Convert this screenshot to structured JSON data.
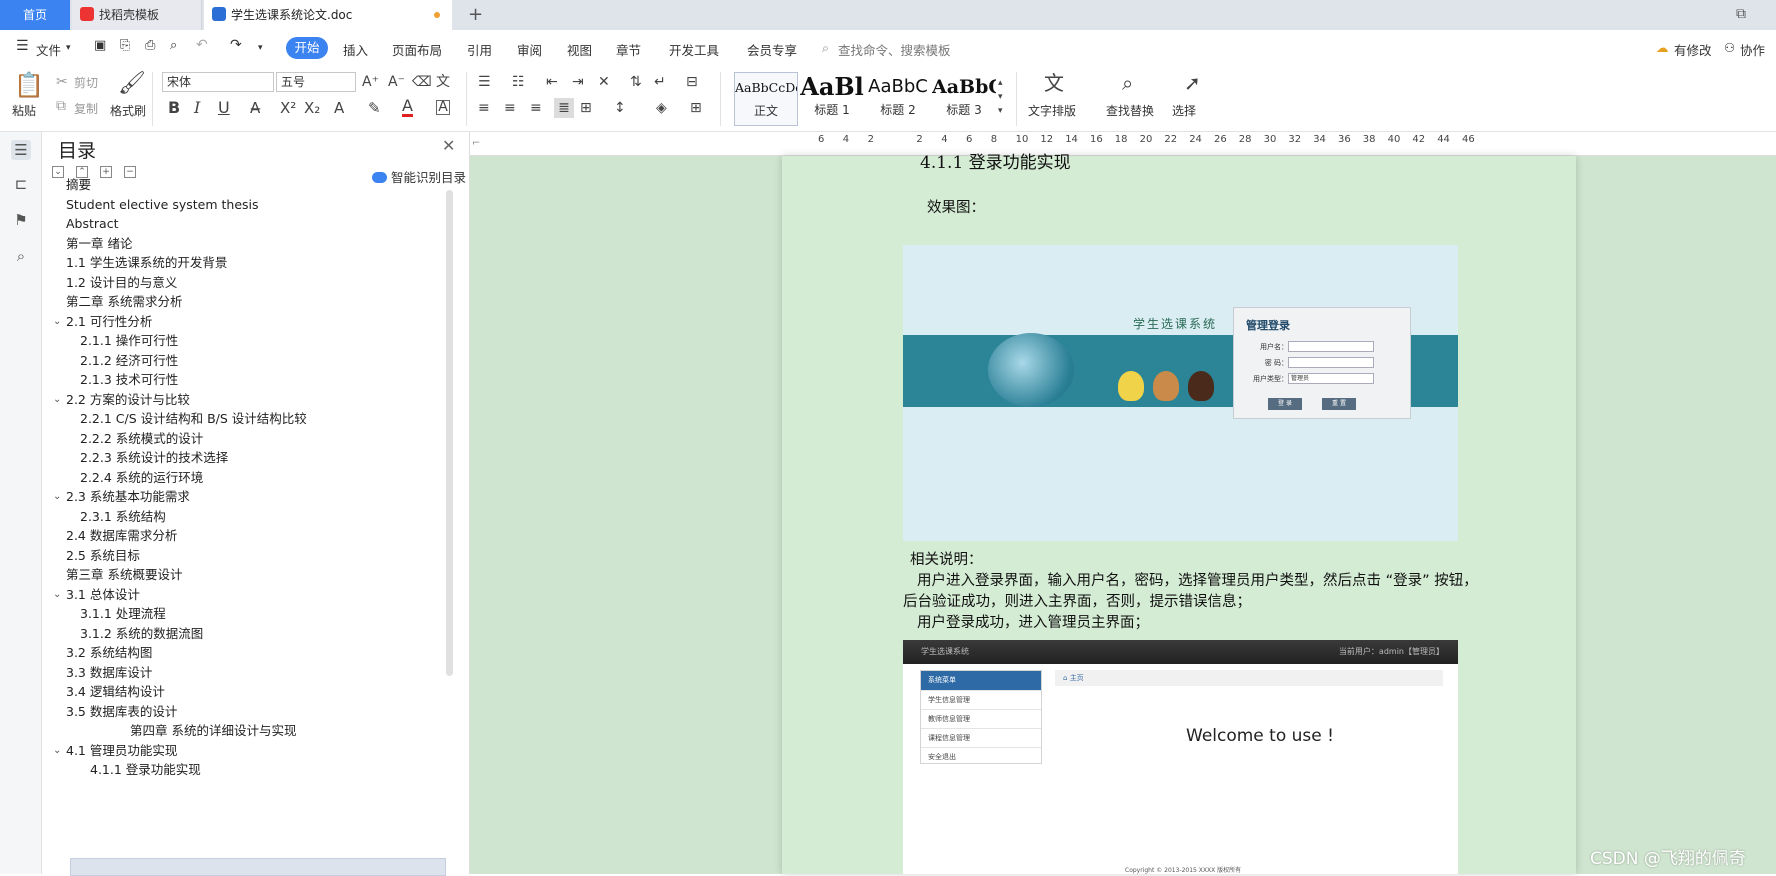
{
  "tabs": {
    "home": "首页",
    "template": "找稻壳模板",
    "document": "学生选课系统论文.doc",
    "add": "+"
  },
  "window_controls": {
    "layout": "⧉"
  },
  "menu": {
    "file": "文件",
    "start": "开始",
    "insert": "插入",
    "layout": "页面布局",
    "reference": "引用",
    "review": "审阅",
    "view": "视图",
    "chapter": "章节",
    "dev": "开发工具",
    "member": "会员专享",
    "search": "查找命令、搜索模板",
    "has_changes": "有修改",
    "collab": "协作"
  },
  "ribbon": {
    "paste": "粘贴",
    "cut": "剪切",
    "copy": "复制",
    "format_painter": "格式刷",
    "font": "宋体",
    "size": "五号",
    "styles": [
      {
        "sample": "AaBbCcDd",
        "name": "正文"
      },
      {
        "sample": "AaBl",
        "name": "标题 1"
      },
      {
        "sample": "AaBbC",
        "name": "标题 2"
      },
      {
        "sample": "AaBbC",
        "name": "标题 3"
      }
    ],
    "text_layout": "文字排版",
    "find_replace": "查找替换",
    "select": "选择"
  },
  "toc": {
    "title": "目录",
    "smart": "智能识别目录",
    "items": [
      {
        "text": "摘要",
        "level": 1,
        "arrow": false
      },
      {
        "text": "Student elective system thesis",
        "level": 1,
        "arrow": false
      },
      {
        "text": "Abstract",
        "level": 1,
        "arrow": false
      },
      {
        "text": "第一章  绪论",
        "level": 1,
        "arrow": false
      },
      {
        "text": "1.1  学生选课系统的开发背景",
        "level": 1,
        "arrow": false
      },
      {
        "text": "1.2 设计目的与意义",
        "level": 1,
        "arrow": false
      },
      {
        "text": "第二章  系统需求分析",
        "level": 1,
        "arrow": false
      },
      {
        "text": "2.1  可行性分析",
        "level": 1,
        "arrow": true
      },
      {
        "text": "2.1.1  操作可行性",
        "level": 2,
        "arrow": false
      },
      {
        "text": "2.1.2  经济可行性",
        "level": 2,
        "arrow": false
      },
      {
        "text": "2.1.3  技术可行性",
        "level": 2,
        "arrow": false
      },
      {
        "text": "2.2 方案的设计与比较",
        "level": 1,
        "arrow": true
      },
      {
        "text": "2.2.1 C/S 设计结构和 B/S 设计结构比较",
        "level": 2,
        "arrow": false
      },
      {
        "text": "2.2.2  系统模式的设计",
        "level": 2,
        "arrow": false
      },
      {
        "text": "2.2.3 系统设计的技术选择",
        "level": 2,
        "arrow": false
      },
      {
        "text": "2.2.4 系统的运行环境",
        "level": 2,
        "arrow": false
      },
      {
        "text": "2.3  系统基本功能需求",
        "level": 1,
        "arrow": true
      },
      {
        "text": "2.3.1  系统结构",
        "level": 2,
        "arrow": false
      },
      {
        "text": "2.4  数据库需求分析",
        "level": 1,
        "arrow": false
      },
      {
        "text": "2.5  系统目标",
        "level": 1,
        "arrow": false
      },
      {
        "text": "第三章  系统概要设计",
        "level": 1,
        "arrow": false
      },
      {
        "text": "3.1 总体设计",
        "level": 1,
        "arrow": true
      },
      {
        "text": "3.1.1  处理流程",
        "level": 2,
        "arrow": false
      },
      {
        "text": "3.1.2 系统的数据流图",
        "level": 2,
        "arrow": false
      },
      {
        "text": "3.2  系统结构图",
        "level": 1,
        "arrow": false
      },
      {
        "text": "3.3 数据库设计",
        "level": 1,
        "arrow": false
      },
      {
        "text": "3.4 逻辑结构设计",
        "level": 1,
        "arrow": false
      },
      {
        "text": "3.5 数据库表的设计",
        "level": 1,
        "arrow": false
      },
      {
        "text": "第四章  系统的详细设计与实现",
        "level": 3,
        "arrow": false
      },
      {
        "text": "4.1  管理员功能实现",
        "level": 1,
        "arrow": true
      },
      {
        "text": "4.1.1  登录功能实现",
        "level": 2,
        "arrow": false
      }
    ]
  },
  "ruler": [
    "6",
    "4",
    "2",
    "2",
    "4",
    "6",
    "8",
    "10",
    "12",
    "14",
    "16",
    "18",
    "20",
    "22",
    "24",
    "26",
    "28",
    "30",
    "32",
    "34",
    "36",
    "38",
    "40",
    "42",
    "44",
    "46"
  ],
  "document": {
    "heading_partial": "4.1.1  登录功能实现",
    "effect_label": "效果图：",
    "desc_title": "相关说明：",
    "desc_line1": "用户进入登录界面，输入用户名，密码，选择管理员用户类型，然后点击 “登录” 按钮，",
    "desc_line2": "后台验证成功，则进入主界面，否则，提示错误信息；",
    "desc_line3": "用户登录成功，进入管理员主界面；"
  },
  "login_screenshot": {
    "system_title": "学生选课系统",
    "box_title": "管理登录",
    "username_label": "用户名：",
    "password_label": "密 码：",
    "usertype_label": "用户类型：",
    "usertype_value": "管理员",
    "login_button": "登 录",
    "reset_button": "重 置"
  },
  "main_screenshot": {
    "app_name": "学生选课系统",
    "current_user": "当前用户：admin【管理员】",
    "menu_header": "系统菜单",
    "menu_items": [
      "学生信息管理",
      "教师信息管理",
      "课程信息管理",
      "安全退出"
    ],
    "breadcrumb": "主页",
    "welcome": "Welcome to use !",
    "copyright": "Copyright © 2013-2015 XXXX 版权所有"
  },
  "watermark": "CSDN @飞翔的佩奇"
}
